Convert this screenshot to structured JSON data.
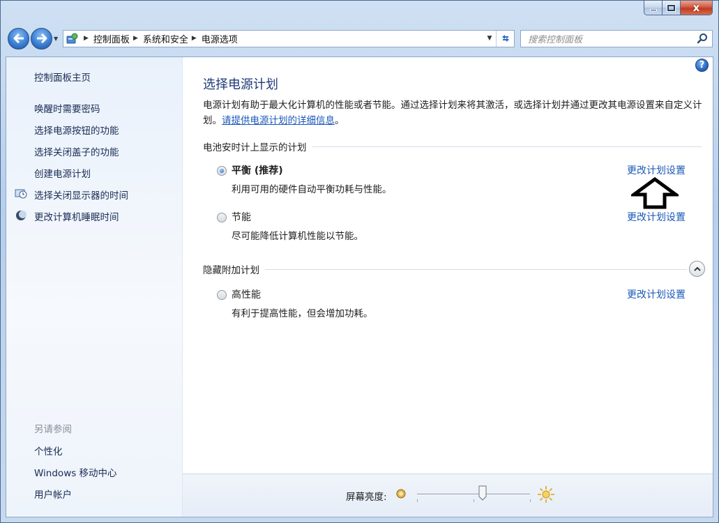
{
  "window": {
    "close_symbol": "x",
    "minimize_icon": "minimize-icon",
    "maximize_icon": "maximize-icon"
  },
  "nav": {
    "back_icon": "back-arrow-icon",
    "forward_icon": "forward-arrow-icon",
    "breadcrumbs": [
      "控制面板",
      "系统和安全",
      "电源选项"
    ],
    "search_placeholder": "搜索控制面板"
  },
  "sidebar": {
    "home": "控制面板主页",
    "links": [
      {
        "label": "唤醒时需要密码",
        "icon": ""
      },
      {
        "label": "选择电源按钮的功能",
        "icon": ""
      },
      {
        "label": "选择关闭盖子的功能",
        "icon": ""
      },
      {
        "label": "创建电源计划",
        "icon": ""
      },
      {
        "label": "选择关闭显示器的时间",
        "icon": "monitor-clock-icon"
      },
      {
        "label": "更改计算机睡眠时间",
        "icon": "moon-icon"
      }
    ],
    "see_also_heading": "另请参阅",
    "see_also": [
      "个性化",
      "Windows 移动中心",
      "用户帐户"
    ]
  },
  "main": {
    "title": "选择电源计划",
    "description": "电源计划有助于最大化计算机的性能或者节能。通过选择计划来将其激活，或选择计划并通过更改其电源设置来自定义计划。",
    "description_link": "请提供电源计划的详细信息",
    "description_end": "。",
    "battery_group": "电池安时计上显示的计划",
    "hidden_group": "隐藏附加计划",
    "plans": [
      {
        "name": "平衡 (推荐)",
        "desc": "利用可用的硬件自动平衡功耗与性能。",
        "selected": true,
        "change": "更改计划设置"
      },
      {
        "name": "节能",
        "desc": "尽可能降低计算机性能以节能。",
        "selected": false,
        "change": "更改计划设置"
      },
      {
        "name": "高性能",
        "desc": "有利于提高性能，但会增加功耗。",
        "selected": false,
        "change": "更改计划设置"
      }
    ]
  },
  "bottom": {
    "brightness_label": "屏幕亮度:",
    "brightness_value": 0.58
  }
}
